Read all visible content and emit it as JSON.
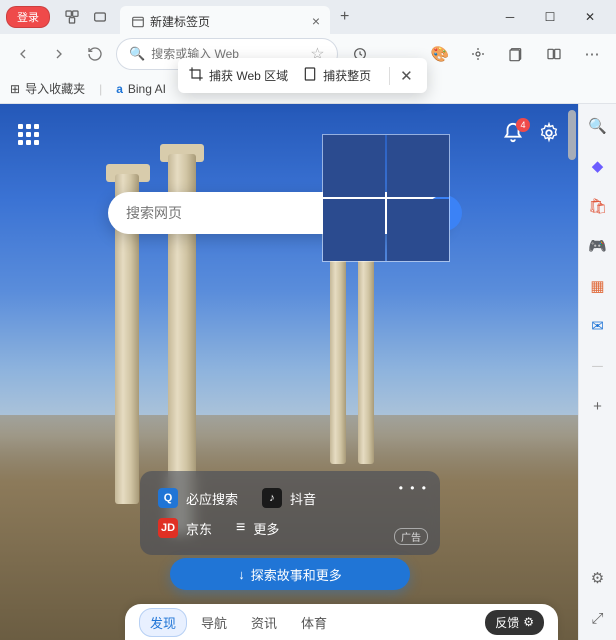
{
  "titlebar": {
    "login": "登录",
    "tab_title": "新建标签页"
  },
  "toolbar": {
    "url_placeholder": "搜索或输入 Web"
  },
  "bookmarks": {
    "import": "导入收藏夹",
    "bing": "Bing AI"
  },
  "capture": {
    "area": "捕获 Web 区域",
    "full": "捕获整页"
  },
  "ntp": {
    "bell_count": "4",
    "search_placeholder": "搜索网页"
  },
  "quicklinks": {
    "bing": "必应搜索",
    "douyin": "抖音",
    "jd": "京东",
    "more": "更多",
    "ad_label": "广告"
  },
  "explore": "探索故事和更多",
  "bottom_tabs": {
    "discover": "发现",
    "nav": "导航",
    "news": "资讯",
    "sports": "体育"
  },
  "feedback": "反馈"
}
